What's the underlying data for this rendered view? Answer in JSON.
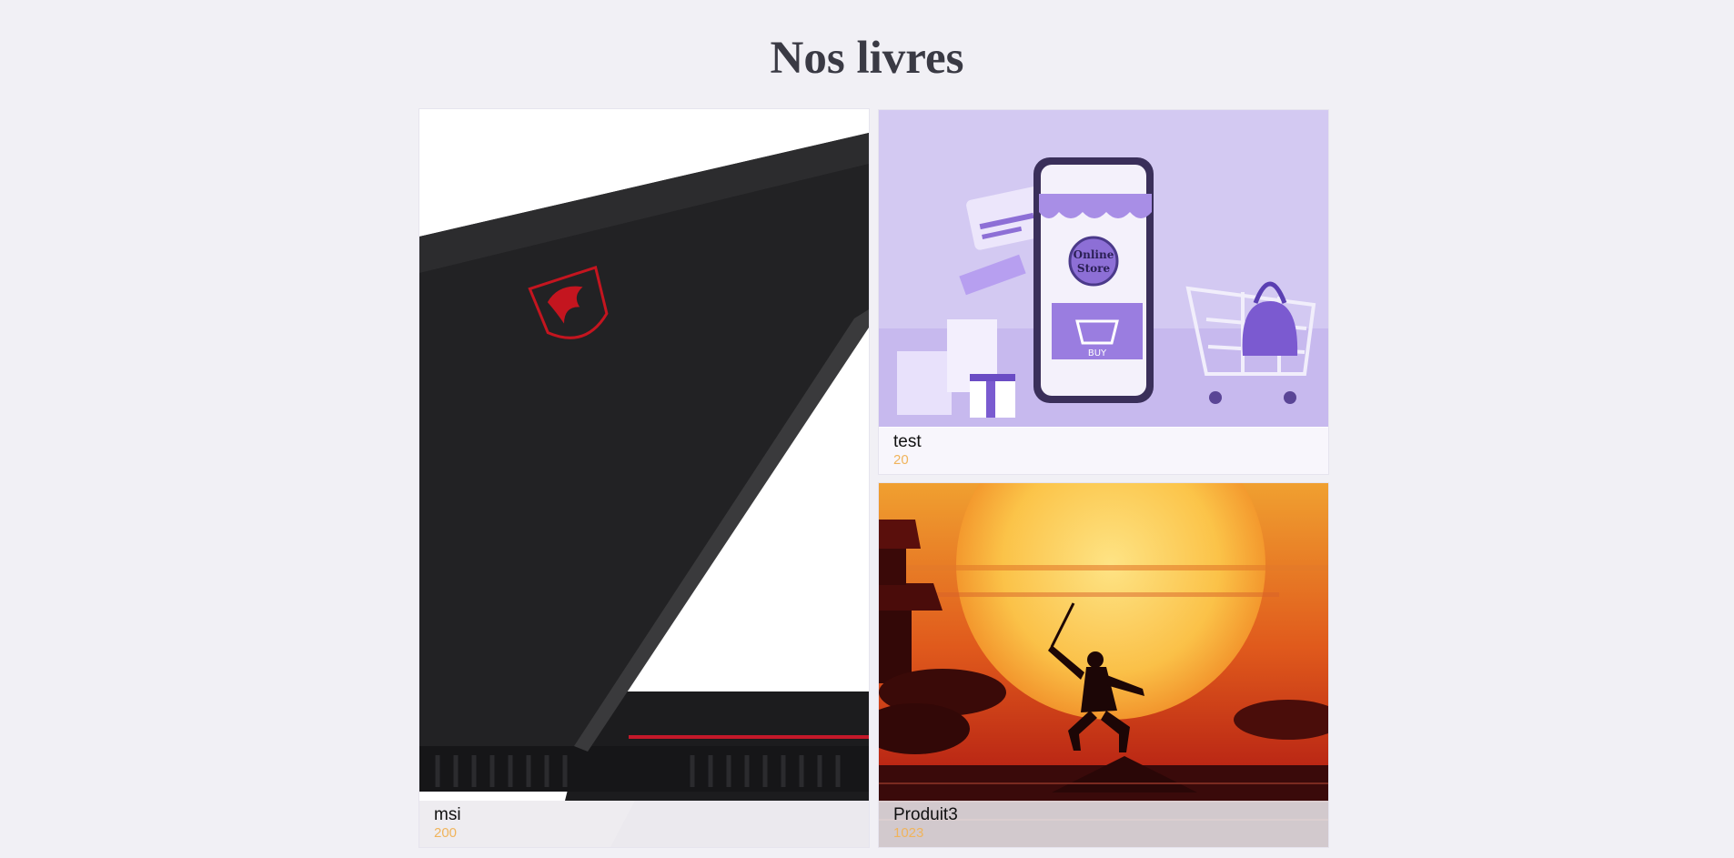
{
  "page": {
    "title": "Nos livres"
  },
  "products": [
    {
      "name": "msi",
      "price": "200",
      "image_icon": "laptop-image"
    },
    {
      "name": "test",
      "price": "20",
      "image_icon": "online-store-image",
      "image_text": [
        "Online",
        "Store",
        "BUY"
      ]
    },
    {
      "name": "Produit3",
      "price": "1023",
      "image_icon": "samurai-sunset-image"
    }
  ],
  "colors": {
    "background": "#f1f0f5",
    "title": "#3a3a44",
    "price": "#f0b45c",
    "name": "#111111"
  }
}
